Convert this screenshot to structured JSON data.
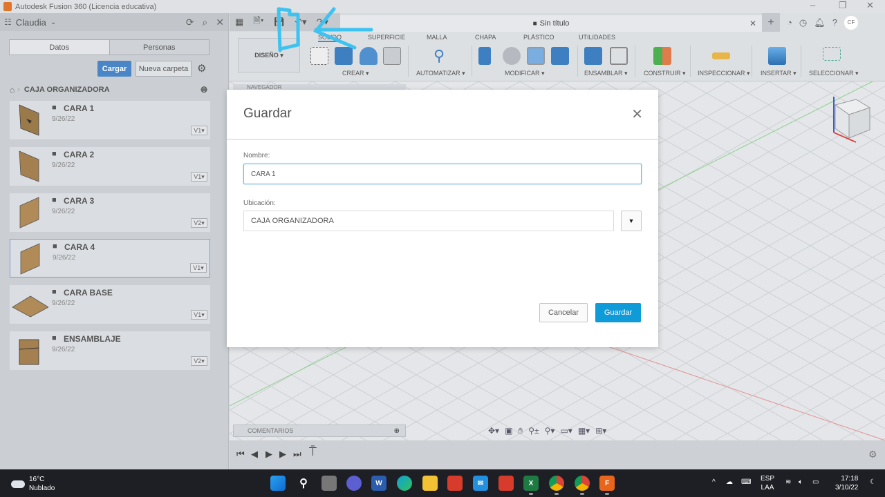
{
  "window": {
    "title": "Autodesk Fusion 360 (Licencia educativa)"
  },
  "data_panel": {
    "team": "Claudia",
    "tabs": [
      {
        "label": "Datos",
        "active": true
      },
      {
        "label": "Personas",
        "active": false
      }
    ],
    "upload_label": "Cargar",
    "new_folder_label": "Nueva carpeta",
    "breadcrumb": "CAJA ORGANIZADORA",
    "files": [
      {
        "name": "CARA 1",
        "date": "9/26/22",
        "version": "V1▾"
      },
      {
        "name": "CARA 2",
        "date": "9/26/22",
        "version": "V1▾"
      },
      {
        "name": "CARA 3",
        "date": "9/26/22",
        "version": "V2▾"
      },
      {
        "name": "CARA 4",
        "date": "9/26/22",
        "version": "V1▾"
      },
      {
        "name": "CARA BASE",
        "date": "9/26/22",
        "version": "V1▾"
      },
      {
        "name": "ENSAMBLAJE",
        "date": "9/26/22",
        "version": "V2▾"
      }
    ]
  },
  "document_tab": {
    "title": "Sin título"
  },
  "user_initials": "CF",
  "ribbon": {
    "workspace": "DISEÑO ▾",
    "tabs": [
      "SÓLIDO",
      "SUPERFICIE",
      "MALLA",
      "CHAPA",
      "PLÁSTICO",
      "UTILIDADES"
    ],
    "groups": [
      "CREAR ▾",
      "AUTOMATIZAR ▾",
      "MODIFICAR ▾",
      "ENSAMBLAR ▾",
      "CONSTRUIR ▾",
      "INSPECCIONAR ▾",
      "INSERTAR ▾",
      "SELECCIONAR ▾"
    ]
  },
  "browser": {
    "navigator_label": "NAVEGADOR",
    "comments_label": "COMENTARIOS"
  },
  "dialog": {
    "title": "Guardar",
    "name_label": "Nombre:",
    "name_value": "CARA 1",
    "location_label": "Ubicación:",
    "location_value": "CAJA ORGANIZADORA",
    "cancel_label": "Cancelar",
    "save_label": "Guardar"
  },
  "taskbar": {
    "weather_temp": "16°C",
    "weather_desc": "Nublado",
    "language": "ESP",
    "layout": "LAA",
    "time": "17:18",
    "date": "3/10/22"
  },
  "colors": {
    "accent": "#0f9ad8",
    "upload": "#4a86c5",
    "annotation": "#3ec3f0"
  }
}
